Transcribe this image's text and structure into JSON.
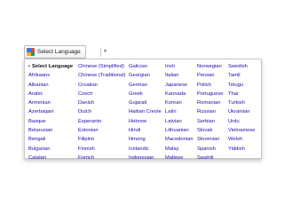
{
  "trigger": {
    "label": "Select Language",
    "caret": "▼"
  },
  "columns": [
    [
      "Select Language",
      "Afrikaans",
      "Albanian",
      "Arabic",
      "Armenian",
      "Azerbaijani",
      "Basque",
      "Belarusian",
      "Bengali",
      "Bulgarian",
      "Catalan"
    ],
    [
      "Chinese (Simplified)",
      "Chinese (Traditional)",
      "Croatian",
      "Czech",
      "Danish",
      "Dutch",
      "Esperanto",
      "Estonian",
      "Filipino",
      "Finnish",
      "French"
    ],
    [
      "Galician",
      "Georgian",
      "German",
      "Greek",
      "Gujarati",
      "Haitian Creole",
      "Hebrew",
      "Hindi",
      "Hmong",
      "Icelandic",
      "Indonesian"
    ],
    [
      "Irish",
      "Italian",
      "Japanese",
      "Kannada",
      "Korean",
      "Latin",
      "Latvian",
      "Lithuanian",
      "Macedonian",
      "Malay",
      "Maltese"
    ],
    [
      "Norwegian",
      "Persian",
      "Polish",
      "Portuguese",
      "Romanian",
      "Russian",
      "Serbian",
      "Slovak",
      "Slovenian",
      "Spanish",
      "Swahili"
    ],
    [
      "Swedish",
      "Tamil",
      "Telugu",
      "Thai",
      "Turkish",
      "Ukrainian",
      "Urdu",
      "Vietnamese",
      "Welsh",
      "Yiddish"
    ]
  ],
  "selected_bullet": "•",
  "colors": {
    "link": "#1a0dab",
    "selected": "#111111"
  }
}
